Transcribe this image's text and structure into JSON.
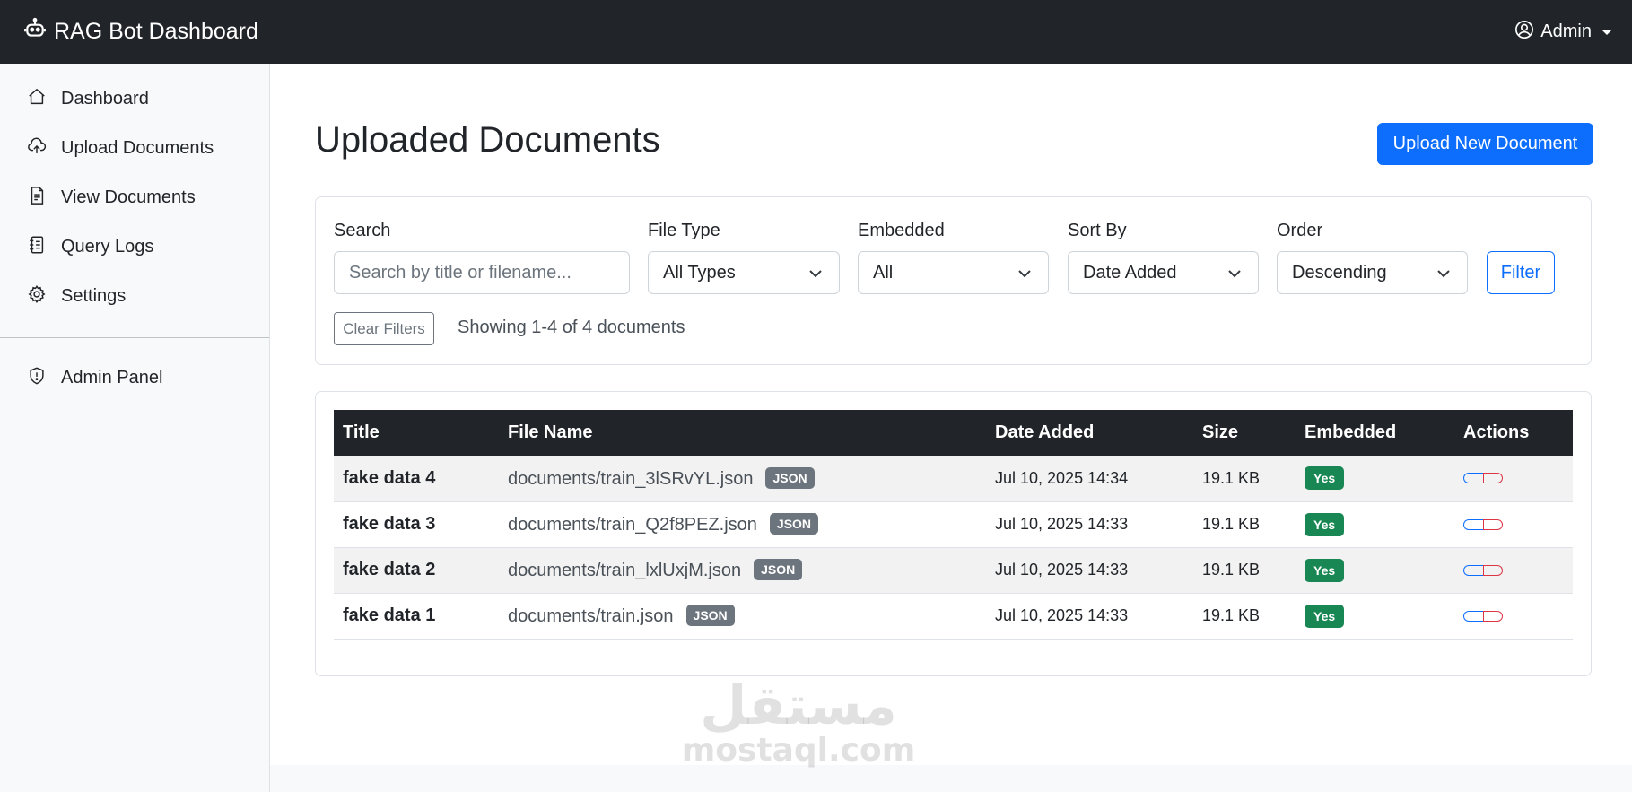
{
  "navbar": {
    "brand": "RAG Bot Dashboard",
    "brand_icon": "robot-icon",
    "user": "Admin",
    "user_icon": "person-circle-icon"
  },
  "sidebar": {
    "items": [
      {
        "label": "Dashboard",
        "icon": "house-icon"
      },
      {
        "label": "Upload Documents",
        "icon": "cloud-upload-icon"
      },
      {
        "label": "View Documents",
        "icon": "file-text-icon"
      },
      {
        "label": "Query Logs",
        "icon": "journal-icon"
      },
      {
        "label": "Settings",
        "icon": "gear-icon"
      }
    ],
    "admin": {
      "label": "Admin Panel",
      "icon": "shield-icon"
    }
  },
  "main": {
    "title": "Uploaded Documents",
    "upload_button": "Upload New Document"
  },
  "filters": {
    "search_label": "Search",
    "search_placeholder": "Search by title or filename...",
    "file_type_label": "File Type",
    "file_type_value": "All Types",
    "embedded_label": "Embedded",
    "embedded_value": "All",
    "sort_by_label": "Sort By",
    "sort_by_value": "Date Added",
    "order_label": "Order",
    "order_value": "Descending",
    "filter_button": "Filter",
    "clear_button": "Clear Filters",
    "showing_text": "Showing 1-4 of 4 documents"
  },
  "table": {
    "headers": [
      "Title",
      "File Name",
      "Date Added",
      "Size",
      "Embedded",
      "Actions"
    ],
    "rows": [
      {
        "title": "fake data 4",
        "file": "documents/train_3lSRvYL.json",
        "type": "JSON",
        "date": "Jul 10, 2025 14:34",
        "size": "19.1 KB",
        "embedded": "Yes"
      },
      {
        "title": "fake data 3",
        "file": "documents/train_Q2f8PEZ.json",
        "type": "JSON",
        "date": "Jul 10, 2025 14:33",
        "size": "19.1 KB",
        "embedded": "Yes"
      },
      {
        "title": "fake data 2",
        "file": "documents/train_lxlUxjM.json",
        "type": "JSON",
        "date": "Jul 10, 2025 14:33",
        "size": "19.1 KB",
        "embedded": "Yes"
      },
      {
        "title": "fake data 1",
        "file": "documents/train.json",
        "type": "JSON",
        "date": "Jul 10, 2025 14:33",
        "size": "19.1 KB",
        "embedded": "Yes"
      }
    ]
  },
  "watermark": {
    "arabic": "مستقل",
    "latin": "mostaql.com"
  },
  "colors": {
    "primary": "#0d6efd",
    "dark": "#212529",
    "success": "#198754",
    "secondary": "#6c757d",
    "danger": "#dc3545"
  }
}
